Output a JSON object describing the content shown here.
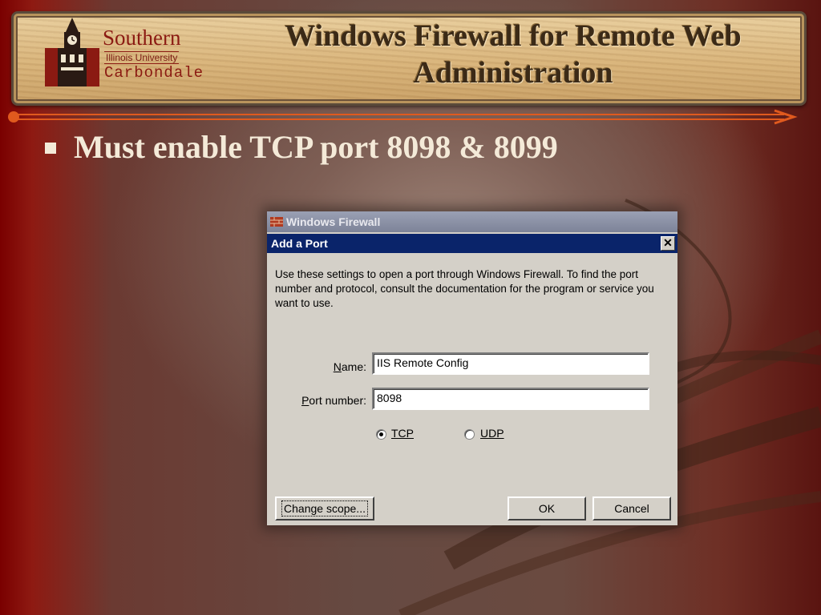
{
  "slide": {
    "logo": {
      "line1": "Southern",
      "line2": "Illinois University",
      "line3": "Carbondale"
    },
    "title_line1": "Windows Firewall for Remote Web",
    "title_line2": "Administration",
    "bullet": "Must enable TCP port 8098 & 8099"
  },
  "colors": {
    "banner_text": "#3b2a17",
    "logo_red": "#8b1a12",
    "bullet_text": "#f4ead8",
    "dialog_titlebar": "#0a246a",
    "rule_arrow": "#e05a1e"
  },
  "window": {
    "title": "Windows Firewall",
    "icon": "firewall-icon"
  },
  "dialog": {
    "title": "Add a Port",
    "close_icon": "close-icon",
    "description": "Use these settings to open a port through Windows Firewall. To find the port number and protocol, consult the documentation for the program or service you want to use.",
    "name_label_pre": "",
    "name_label_key": "N",
    "name_label_post": "ame:",
    "name_value": "IIS Remote Config",
    "port_label_pre": "",
    "port_label_key": "P",
    "port_label_post": "ort number:",
    "port_value": "8098",
    "tcp_label": "TCP",
    "udp_label": "UDP",
    "protocol_selected": "TCP",
    "change_scope_label": "Change scope...",
    "ok_label": "OK",
    "cancel_label": "Cancel"
  }
}
